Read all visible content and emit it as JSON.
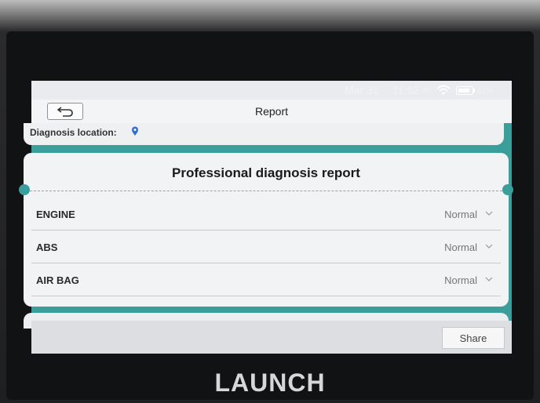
{
  "status_bar": {
    "date": "Mar 31",
    "time": "11:52",
    "ampm": "AM",
    "battery": "61%",
    "icons": [
      "wifi-icon",
      "battery-icon"
    ]
  },
  "header": {
    "back_icon": "back-arrow-icon",
    "title": "Report"
  },
  "location": {
    "label": "Diagnosis location:",
    "icon": "location-pin-icon"
  },
  "report": {
    "title": "Professional diagnosis report",
    "rows": [
      {
        "name": "ENGINE",
        "status": "Normal"
      },
      {
        "name": "ABS",
        "status": "Normal"
      },
      {
        "name": "AIR BAG",
        "status": "Normal"
      }
    ]
  },
  "footer": {
    "share_label": "Share"
  },
  "device": {
    "brand": "LAUNCH"
  },
  "colors": {
    "accent_teal": "#3a9e9a",
    "pin_blue": "#2f6fd6"
  }
}
